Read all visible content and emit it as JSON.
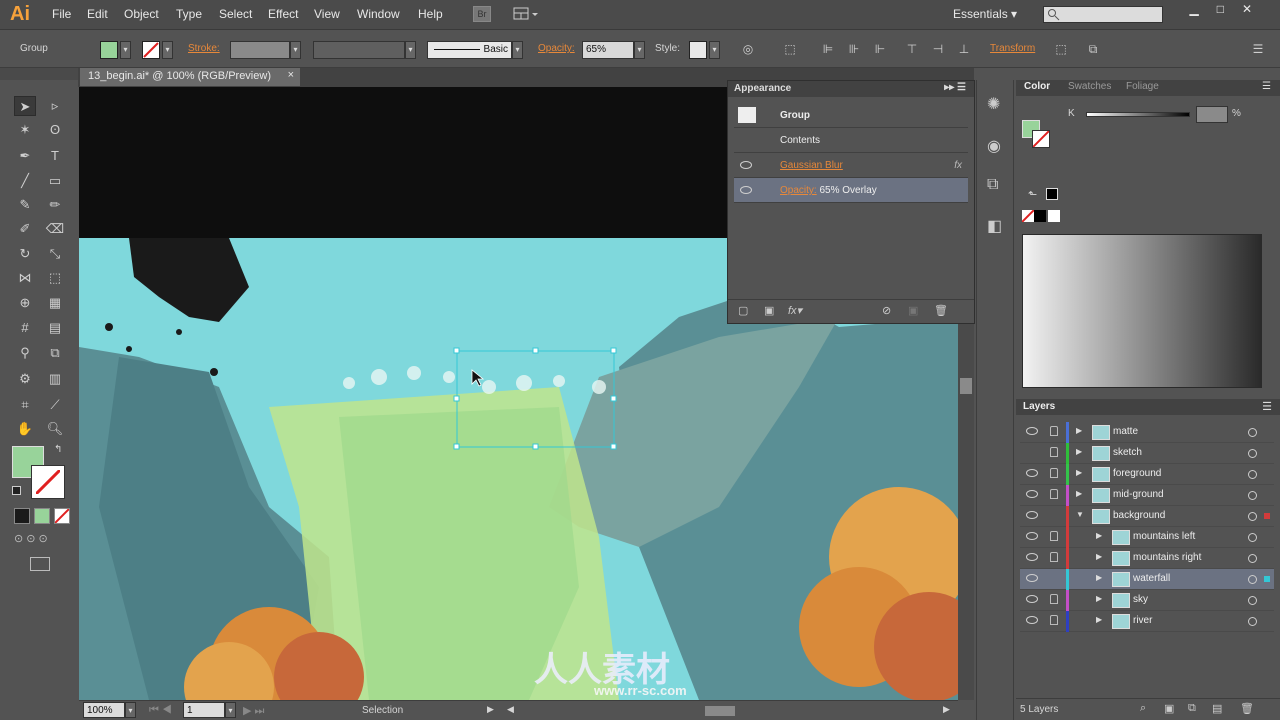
{
  "app": {
    "logo": "Ai"
  },
  "menu": [
    "File",
    "Edit",
    "Object",
    "Type",
    "Select",
    "Effect",
    "View",
    "Window",
    "Help"
  ],
  "toolbar_top": {
    "br_label": "Br",
    "workspace": "Essentials"
  },
  "controlbar": {
    "selection": "Group",
    "stroke_label": "Stroke:",
    "brush_label": "Basic",
    "opacity_label": "Opacity:",
    "opacity_value": "65%",
    "style_label": "Style:",
    "transform_label": "Transform"
  },
  "document": {
    "tab_title": "13_begin.ai* @ 100% (RGB/Preview)",
    "close": "×"
  },
  "status": {
    "zoom": "100%",
    "artboard": "1",
    "tool": "Selection"
  },
  "appearance": {
    "title": "Appearance",
    "object": "Group",
    "contents": "Contents",
    "effect": "Gaussian Blur",
    "fx": "fx",
    "opacity_label": "Opacity:",
    "opacity_value": "65% Overlay"
  },
  "color_panel": {
    "tabs": [
      "Color",
      "Swatches",
      "Foliage"
    ],
    "channel": "K",
    "percent": "%"
  },
  "layers": {
    "title": "Layers",
    "count": "5 Layers",
    "items": [
      {
        "name": "matte",
        "color": "#4a6fd6"
      },
      {
        "name": "sketch",
        "color": "#2fbf3a"
      },
      {
        "name": "foreground",
        "color": "#34c34a"
      },
      {
        "name": "mid-ground",
        "color": "#c44fc8"
      },
      {
        "name": "background",
        "color": "#d23b3b"
      },
      {
        "name": "mountains left",
        "color": "#d23b3b"
      },
      {
        "name": "mountains right",
        "color": "#d23b3b"
      },
      {
        "name": "waterfall",
        "color": "#34c7d6"
      },
      {
        "name": "sky",
        "color": "#c44fc8"
      },
      {
        "name": "river",
        "color": "#2e3fc2"
      }
    ]
  },
  "watermark": {
    "cn": "人人素材",
    "url": "www.rr-sc.com"
  },
  "colors": {
    "fill": "#98d39a",
    "sky": "#7fd8dc",
    "cliff": "#5a8f95",
    "accent": "#e7883a"
  }
}
